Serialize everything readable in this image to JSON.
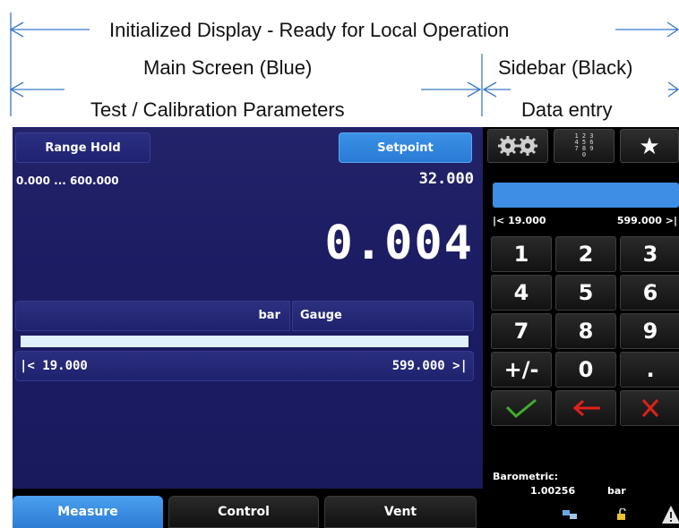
{
  "annotations": {
    "top_line": "Initialized Display - Ready for Local Operation",
    "main_label": "Main Screen (Blue)",
    "sidebar_label": "Sidebar (Black)",
    "params_label": "Test / Calibration Parameters",
    "entry_label": "Data entry"
  },
  "main": {
    "range_hold_label": "Range Hold",
    "setpoint_label": "Setpoint",
    "range_text": "0.000 ... 600.000",
    "setpoint_value": "32.000",
    "reading": "0.004",
    "unit": "bar",
    "mode": "Gauge",
    "progress_fraction": 0.0,
    "limit_min": "|<  19.000",
    "limit_max": "599.000  >|"
  },
  "tabs": [
    {
      "label": "Measure",
      "active": true
    },
    {
      "label": "Control",
      "active": false
    },
    {
      "label": "Vent",
      "active": false
    }
  ],
  "sidebar": {
    "gears_icon": "gears-icon",
    "keypad_icon": "keypad-icon",
    "star_icon": "star-icon",
    "entry_value": "",
    "limit_min": "|< 19.000",
    "limit_max": "599.000 >|",
    "keys": [
      "1",
      "2",
      "3",
      "4",
      "5",
      "6",
      "7",
      "8",
      "9",
      "+/-",
      "0",
      "."
    ],
    "confirm_icon": "check-icon",
    "backspace_icon": "backspace-arrow-icon",
    "cancel_icon": "x-icon",
    "barometric_label": "Barometric:",
    "barometric_value": "1.00256",
    "barometric_unit": "bar",
    "status_icons": [
      "network-icon",
      "unlock-icon",
      "warning-icon"
    ]
  },
  "colors": {
    "main_bg": "#1c1c63",
    "accent_blue": "#2c7bd4",
    "confirm_green": "#3fae2a",
    "cancel_red": "#e0201a"
  }
}
